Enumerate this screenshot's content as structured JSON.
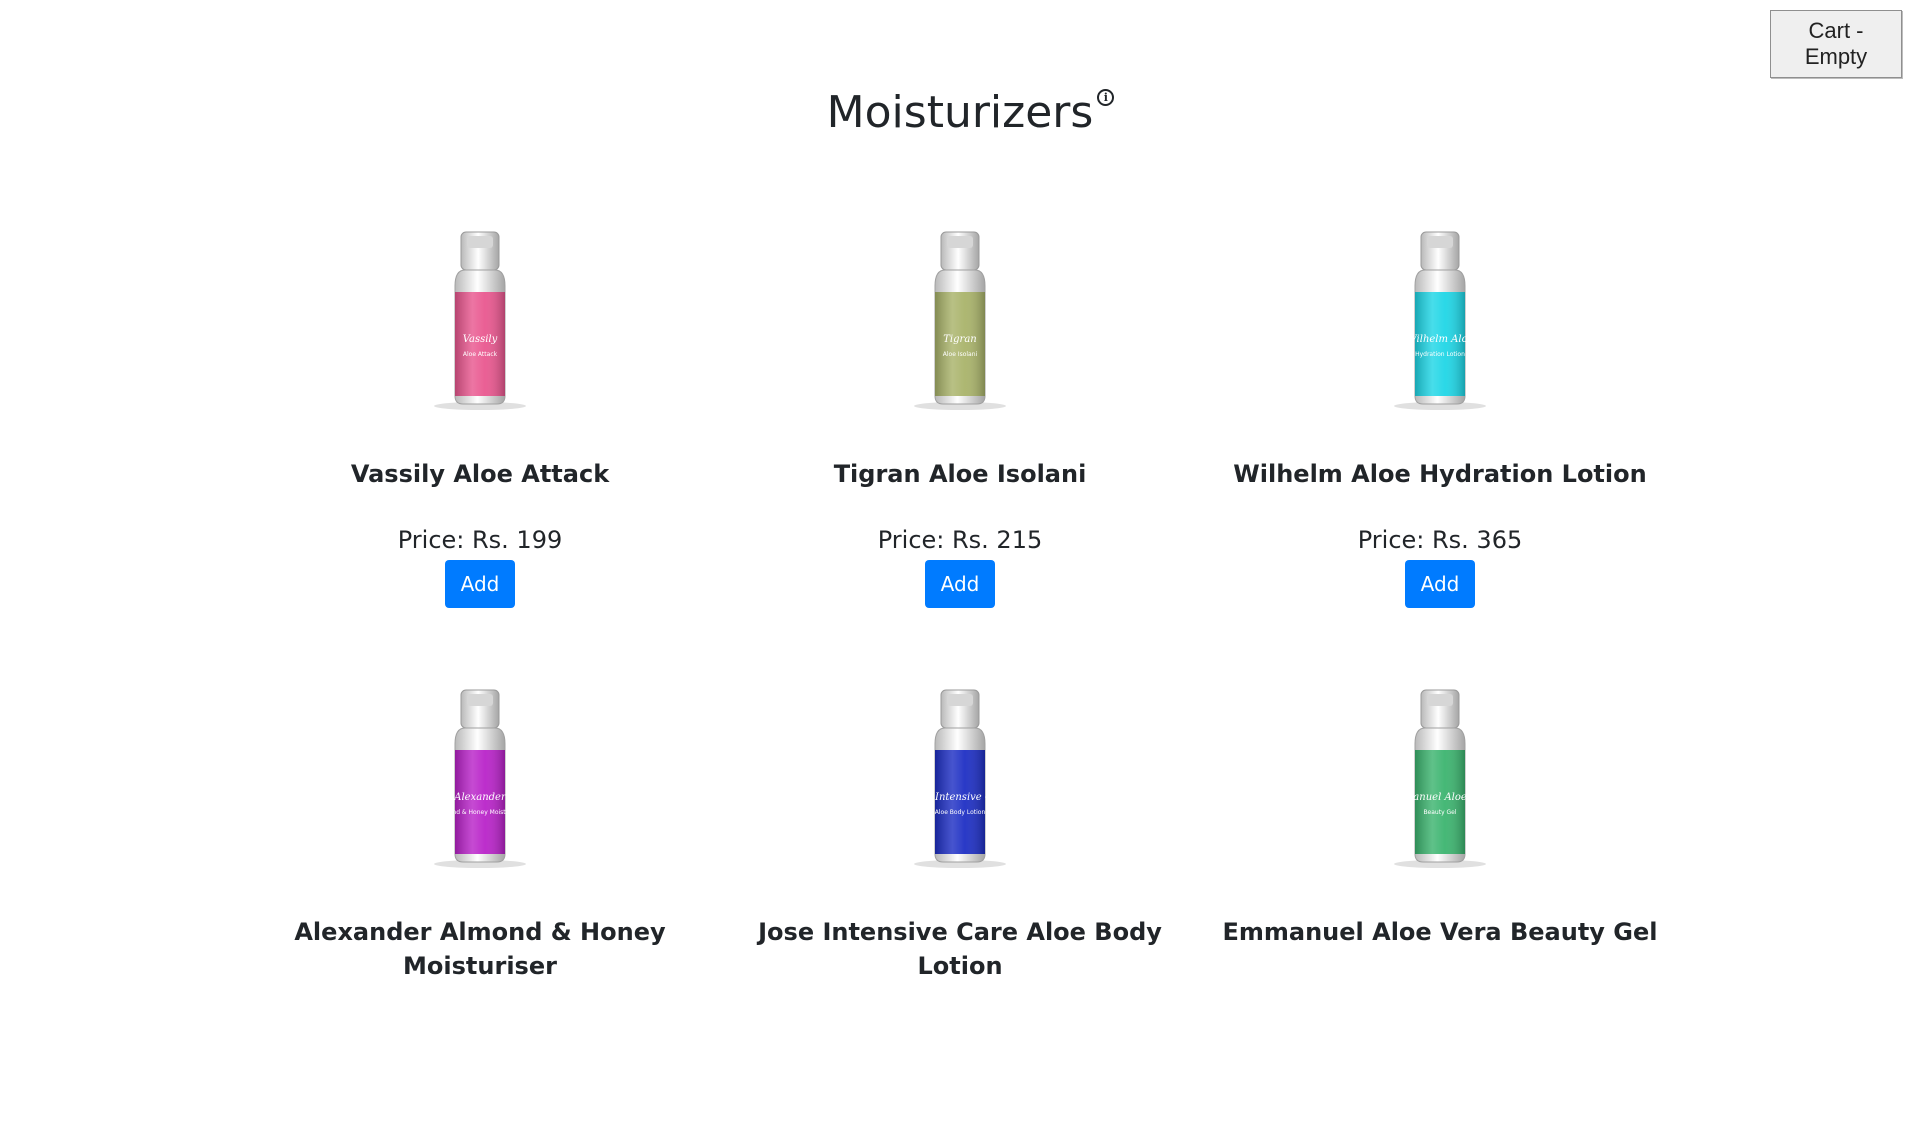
{
  "cart": {
    "label": "Cart - Empty"
  },
  "page": {
    "title": "Moisturizers",
    "info_icon": "info-icon"
  },
  "products": [
    {
      "name": "Vassily Aloe Attack",
      "price": "Price: Rs. 199",
      "add_label": "Add",
      "color": "#e9578f",
      "bottle_brand": "Vassily",
      "bottle_sub": "Aloe Attack"
    },
    {
      "name": "Tigran Aloe Isolani",
      "price": "Price: Rs. 215",
      "add_label": "Add",
      "color": "#a9b36a",
      "bottle_brand": "Tigran",
      "bottle_sub": "Aloe Isolani"
    },
    {
      "name": "Wilhelm Aloe Hydration Lotion",
      "price": "Price: Rs. 365",
      "add_label": "Add",
      "color": "#1fd6e6",
      "bottle_brand": "Wilhelm Aloe",
      "bottle_sub": "Hydration Lotion"
    },
    {
      "name": "Alexander Almond & Honey Moisturiser",
      "price": "",
      "add_label": "",
      "color": "#b923c9",
      "bottle_brand": "Alexander",
      "bottle_sub": "Almond & Honey Moisturiser"
    },
    {
      "name": "Jose Intensive Care Aloe Body Lotion",
      "price": "",
      "add_label": "",
      "color": "#1e2fc4",
      "bottle_brand": "Jose Intensive Care",
      "bottle_sub": "Aloe Body Lotion"
    },
    {
      "name": "Emmanuel Aloe Vera Beauty Gel",
      "price": "",
      "add_label": "",
      "color": "#3cb46f",
      "bottle_brand": "Emmanuel Aloe Vera",
      "bottle_sub": "Beauty Gel"
    }
  ]
}
